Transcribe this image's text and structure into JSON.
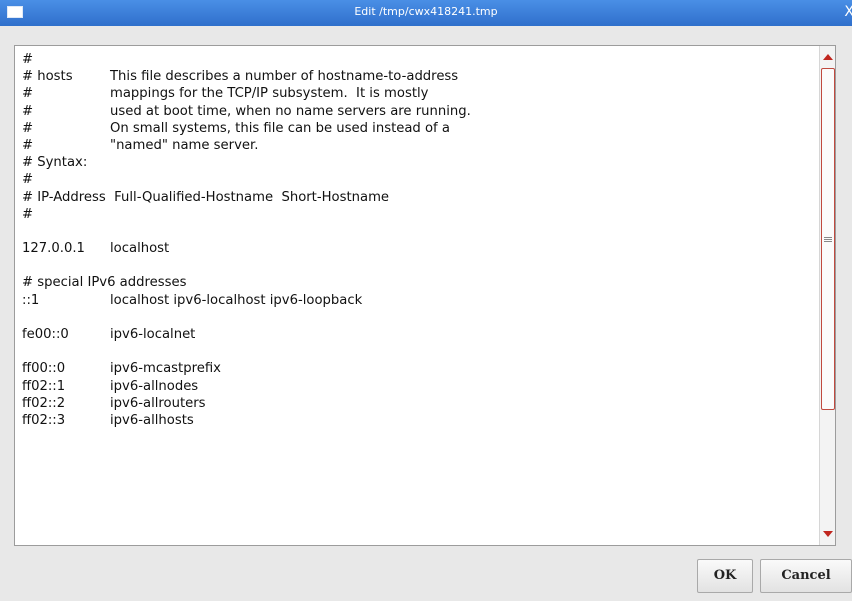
{
  "window": {
    "title": "Edit /tmp/cwx418241.tmp",
    "close_glyph": "X"
  },
  "editor": {
    "lines": [
      [
        "#",
        ""
      ],
      [
        "# hosts",
        "This file describes a number of hostname-to-address"
      ],
      [
        "#",
        "mappings for the TCP/IP subsystem.  It is mostly"
      ],
      [
        "#",
        "used at boot time, when no name servers are running."
      ],
      [
        "#",
        "On small systems, this file can be used instead of a"
      ],
      [
        "#",
        "\"named\" name server."
      ],
      [
        "# Syntax:",
        ""
      ],
      [
        "#",
        ""
      ],
      [
        "# IP-Address  Full-Qualified-Hostname  Short-Hostname",
        ""
      ],
      [
        "#",
        ""
      ],
      [
        "",
        ""
      ],
      [
        "127.0.0.1",
        "localhost"
      ],
      [
        "",
        ""
      ],
      [
        "# special IPv6 addresses",
        ""
      ],
      [
        "::1",
        "localhost ipv6-localhost ipv6-loopback"
      ],
      [
        "",
        ""
      ],
      [
        "fe00::0",
        "ipv6-localnet"
      ],
      [
        "",
        ""
      ],
      [
        "ff00::0",
        "ipv6-mcastprefix"
      ],
      [
        "ff02::1",
        "ipv6-allnodes"
      ],
      [
        "ff02::2",
        "ipv6-allrouters"
      ],
      [
        "ff02::3",
        "ipv6-allhosts"
      ]
    ]
  },
  "buttons": {
    "ok": "OK",
    "cancel": "Cancel"
  },
  "colors": {
    "titlebar": "#3a7fd8",
    "scroll_accent": "#c0261f"
  }
}
